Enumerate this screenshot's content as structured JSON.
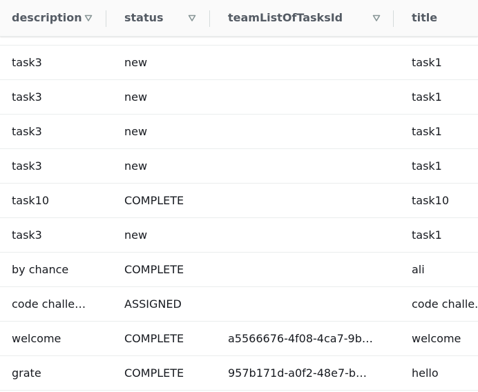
{
  "columns": {
    "description": "description",
    "status": "status",
    "teamListOfTasksId": "teamListOfTasksId",
    "title": "title"
  },
  "icons": {
    "sort": "sort-descending-triangle-icon",
    "sort_color": "#879596"
  },
  "rows": [
    {
      "description": "task3",
      "status": "new",
      "teamListOfTasksId": "",
      "title": "task1"
    },
    {
      "description": "task3",
      "status": "new",
      "teamListOfTasksId": "",
      "title": "task1"
    },
    {
      "description": "task3",
      "status": "new",
      "teamListOfTasksId": "",
      "title": "task1"
    },
    {
      "description": "task3",
      "status": "new",
      "teamListOfTasksId": "",
      "title": "task1"
    },
    {
      "description": "task10",
      "status": "COMPLETE",
      "teamListOfTasksId": "",
      "title": "task10"
    },
    {
      "description": "task3",
      "status": "new",
      "teamListOfTasksId": "",
      "title": "task1"
    },
    {
      "description": "by chance",
      "status": "COMPLETE",
      "teamListOfTasksId": "",
      "title": "ali"
    },
    {
      "description": "code challe…",
      "status": "ASSIGNED",
      "teamListOfTasksId": "",
      "title": "code challe."
    },
    {
      "description": "welcome",
      "status": "COMPLETE",
      "teamListOfTasksId": "a5566676-4f08-4ca7-9b…",
      "title": "welcome"
    },
    {
      "description": "grate",
      "status": "COMPLETE",
      "teamListOfTasksId": "957b171d-a0f2-48e7-b…",
      "title": "hello"
    }
  ]
}
